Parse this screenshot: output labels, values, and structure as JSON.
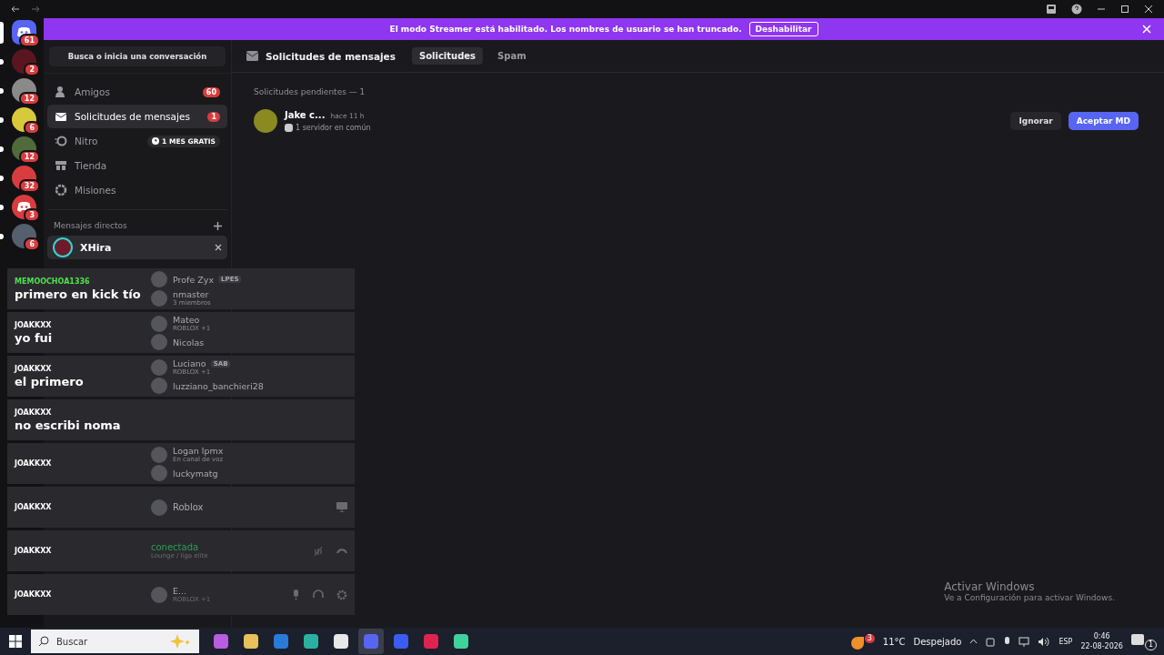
{
  "servers": [
    {
      "kind": "home",
      "badge": "61",
      "selected": true
    },
    {
      "kind": "avatar",
      "badge": "2",
      "selected": false
    },
    {
      "kind": "avatar",
      "badge": "12",
      "selected": false
    },
    {
      "kind": "avatar",
      "badge": "6",
      "selected": false
    },
    {
      "kind": "avatar",
      "badge": "12",
      "selected": false
    },
    {
      "kind": "avatar",
      "badge": "32",
      "selected": false
    },
    {
      "kind": "logo",
      "badge": "3",
      "selected": false
    },
    {
      "kind": "avatar",
      "badge": "6",
      "selected": false
    }
  ],
  "banner": {
    "text": "El modo Streamer está habilitado. Los nombres de usuario se han truncado.",
    "button": "Deshabilitar"
  },
  "sidebar": {
    "search": "Busca o inicia una conversación",
    "items": [
      {
        "kind": "friends",
        "label": "Amigos",
        "badge": "60",
        "selected": false
      },
      {
        "kind": "requests",
        "label": "Solicitudes de mensajes",
        "badge": "1",
        "selected": true
      },
      {
        "kind": "nitro",
        "label": "Nitro",
        "promo": "1 MES GRATIS",
        "selected": false
      },
      {
        "kind": "shop",
        "label": "Tienda",
        "selected": false
      },
      {
        "kind": "quests",
        "label": "Misiones",
        "selected": false
      }
    ],
    "dm_header": "Mensajes directos",
    "direct_messages": [
      {
        "name": "XHira",
        "selected": true
      }
    ]
  },
  "header": {
    "title": "Solicitudes de mensajes",
    "tabs": [
      {
        "label": "Solicitudes",
        "selected": true
      },
      {
        "label": "Spam",
        "selected": false
      }
    ]
  },
  "requests": {
    "heading": "Solicitudes pendientes — 1",
    "items": [
      {
        "name": "Jake c...",
        "time": "hace 11 h",
        "mutual": "1 servidor en común",
        "ignore": "Ignorar",
        "accept": "Aceptar MD"
      }
    ]
  },
  "chat_overlay": [
    {
      "user": "MEMOOCHOA1336",
      "highlight": true,
      "message": "primero en kick tío",
      "behind": [
        {
          "kind": "dm",
          "name": "Profe Zyx",
          "tag": "LPES"
        },
        {
          "kind": "dm",
          "name": "nmaster",
          "sub": "3 miembros"
        }
      ]
    },
    {
      "user": "JOAKKXX",
      "highlight": false,
      "message": "yo fui",
      "behind": [
        {
          "kind": "dm",
          "name": "Mateo",
          "sub": "ROBLOX +1"
        },
        {
          "kind": "dm",
          "name": "Nicolas"
        }
      ]
    },
    {
      "user": "JOAKKXX",
      "highlight": false,
      "message": "el primero",
      "behind": [
        {
          "kind": "dm",
          "name": "Luciano",
          "tag": "SAB",
          "sub": "ROBLOX +1"
        },
        {
          "kind": "dm",
          "name": "luzziano_banchieri28"
        }
      ]
    },
    {
      "user": "JOAKKXX",
      "highlight": false,
      "message": "no escribi noma"
    },
    {
      "user": "JOAKKXX",
      "highlight": false,
      "behind": [
        {
          "kind": "dm",
          "name": "Logan lpmx",
          "sub": "En canal de voz"
        },
        {
          "kind": "dm",
          "name": "luckymatg"
        }
      ]
    },
    {
      "user": "JOAKKXX",
      "highlight": false,
      "behind": [
        {
          "kind": "activity",
          "name": "Roblox"
        }
      ]
    },
    {
      "user": "JOAKKXX",
      "highlight": false,
      "behind": [
        {
          "kind": "voice",
          "name": "conectada",
          "sub": "Lounge / liga elite"
        }
      ]
    },
    {
      "user": "JOAKKXX",
      "highlight": false,
      "behind": [
        {
          "kind": "user",
          "name": "E...",
          "sub": "ROBLOX +1"
        }
      ]
    }
  ],
  "activation": {
    "title": "Activar Windows",
    "text": "Ve a Configuración para activar Windows."
  },
  "taskbar": {
    "search": "Buscar",
    "weather_badge": "3",
    "temperature": "11°C",
    "weather": "Despejado",
    "language": "ESP",
    "time": "0:46",
    "date": "22-08-2026",
    "notifications": "1"
  }
}
